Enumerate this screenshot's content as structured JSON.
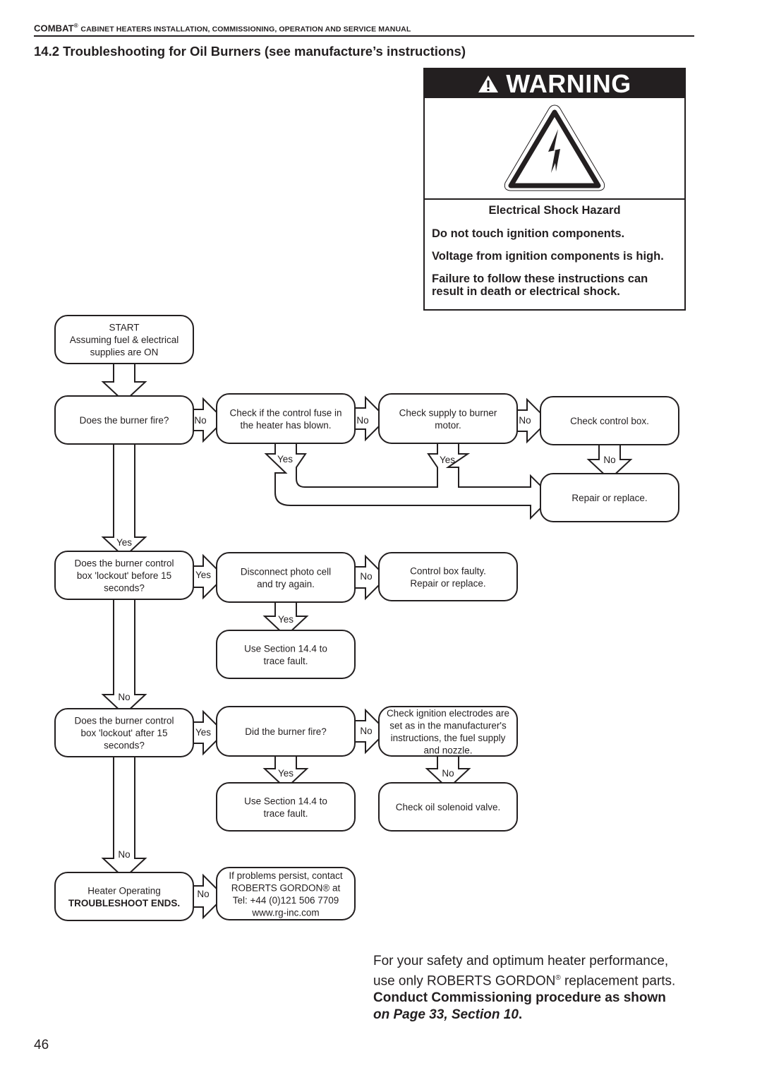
{
  "header": {
    "brand": "COMBAT",
    "brand_mark": "®",
    "title_rest": "Cabinet Heaters Installation, Commissioning, Operation and Service Manual"
  },
  "section_title": "14.2 Troubleshooting for Oil Burners (see manufacture’s instructions)",
  "warning": {
    "banner": "WARNING",
    "banner_icon": "alert-triangle-icon",
    "pictogram": "electrical-shock-icon",
    "heading": "Electrical Shock Hazard",
    "lines": [
      "Do not touch ignition components.",
      "Voltage from ignition components is high.",
      "Failure to follow these instructions can result in death or electrical shock."
    ]
  },
  "flowchart": {
    "nodes": {
      "start": [
        "START",
        "Assuming fuel & electrical",
        "supplies are ON"
      ],
      "q_fire": [
        "Does the burner fire?"
      ],
      "fuse": [
        "Check if the control fuse in",
        "the heater has blown."
      ],
      "supply": [
        "Check supply to burner",
        "motor."
      ],
      "ctrlbox": [
        "Check control box."
      ],
      "repair": [
        "Repair or replace."
      ],
      "q_lock_before": [
        "Does the burner control",
        "box 'lockout' before 15",
        "seconds?"
      ],
      "photocell": [
        "Disconnect photo cell",
        "and try again."
      ],
      "faulty": [
        "Control box faulty.",
        "Repair or replace."
      ],
      "use144_a": [
        "Use Section 14.4 to",
        "trace fault."
      ],
      "q_lock_after": [
        "Does the burner control",
        "box 'lockout' after 15",
        "seconds?"
      ],
      "q_fire2": [
        "Did the burner fire?"
      ],
      "electrodes": [
        "Check ignition electrodes are",
        "set as in the manufacturer's",
        "instructions, the fuel supply",
        "and nozzle."
      ],
      "use144_b": [
        "Use Section 14.4 to",
        "trace fault."
      ],
      "solenoid": [
        "Check oil solenoid valve."
      ],
      "operating": [
        "Heater Operating",
        "TROUBLESHOOT ENDS."
      ],
      "contact": [
        "If problems persist, contact",
        "ROBERTS GORDON® at",
        "Tel: +44 (0)121 506 7709",
        "www.rg-inc.com"
      ]
    },
    "labels": {
      "fire_no": "No",
      "fuse_no": "No",
      "supply_no": "No",
      "fuse_yes": "Yes",
      "supply_yes": "Yes",
      "ctrlbox_no": "No",
      "fire_yes": "Yes",
      "before_yes": "Yes",
      "photocell_no": "No",
      "photocell_yes": "Yes",
      "before_no": "No",
      "after_yes": "Yes",
      "fire2_no": "No",
      "fire2_yes": "Yes",
      "electrodes_no": "No",
      "after_no": "No",
      "operating_no": "No"
    }
  },
  "footer_note": {
    "line1": "For your safety and optimum heater performance,",
    "line2_a": "use only ROBERTS GORDON",
    "line2_mark": "®",
    "line2_b": " replacement parts.",
    "line3": "Conduct Commissioning procedure as shown",
    "line4_a": "on Page 33, Section 10",
    "line4_b": "."
  },
  "page_number": "46"
}
